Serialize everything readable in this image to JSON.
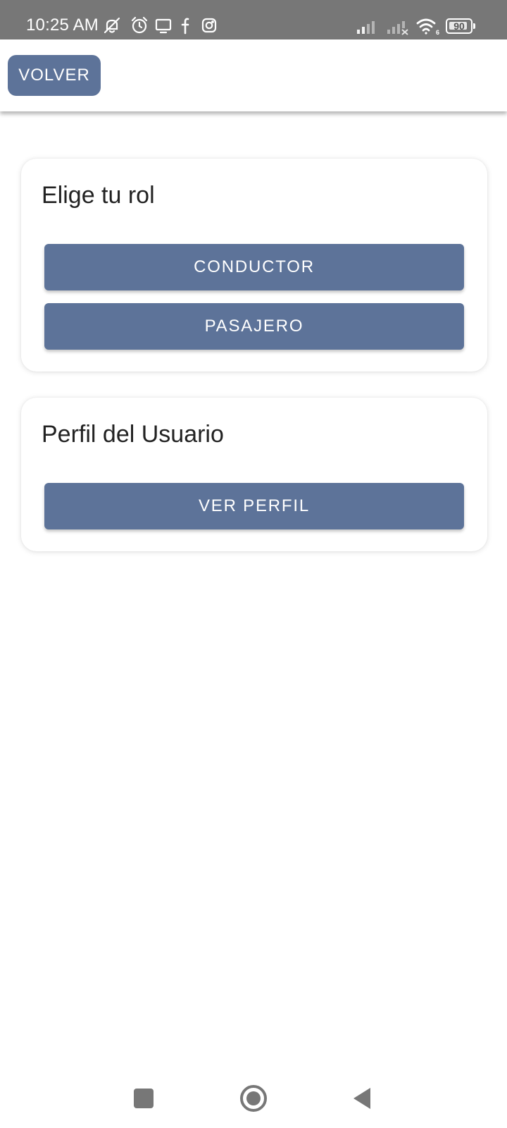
{
  "status_bar": {
    "time": "10:25 AM",
    "icons": [
      "notifications-muted-icon",
      "alarm-icon",
      "cast-screen-icon",
      "facebook-icon",
      "instagram-icon",
      "signal-strength-icon",
      "signal-no-service-icon",
      "wifi-icon"
    ],
    "wifi_label": "6",
    "battery_level": "90",
    "battery_fraction": 0.9,
    "background_color": "#777777"
  },
  "app_bar": {
    "back_label": "VOLVER"
  },
  "role_card": {
    "title": "Elige tu rol",
    "buttons": [
      {
        "label": "CONDUCTOR"
      },
      {
        "label": "PASAJERO"
      }
    ]
  },
  "profile_card": {
    "title": "Perfil del Usuario",
    "button_label": "VER PERFIL"
  },
  "nav_bar": {
    "icons": [
      "recents-icon",
      "home-icon",
      "back-icon"
    ]
  },
  "colors": {
    "accent": "#5d7399",
    "title_text": "#222222",
    "background": "#ffffff"
  }
}
